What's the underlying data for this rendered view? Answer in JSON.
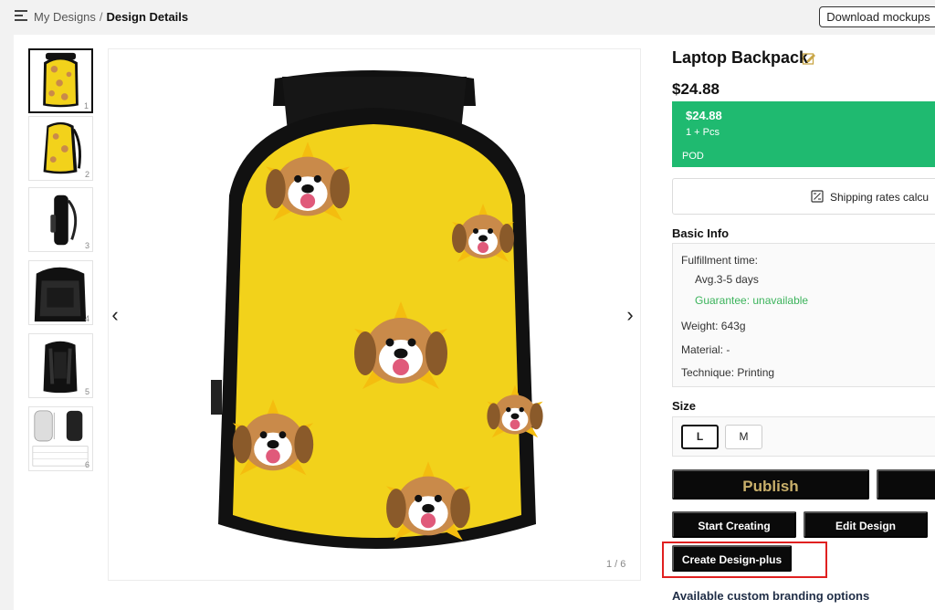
{
  "breadcrumb": {
    "parent": "My Designs",
    "separator": "/",
    "current": "Design Details"
  },
  "download_button": "Download mockups",
  "thumbnails": [
    {
      "num": "1",
      "view": "front"
    },
    {
      "num": "2",
      "view": "angle"
    },
    {
      "num": "3",
      "view": "side"
    },
    {
      "num": "4",
      "view": "inside"
    },
    {
      "num": "5",
      "view": "back"
    },
    {
      "num": "6",
      "view": "size-chart"
    }
  ],
  "viewer": {
    "counter": "1 / 6",
    "prev_icon": "chevron-left-icon",
    "next_icon": "chevron-right-icon"
  },
  "product": {
    "title": "Laptop Backpack",
    "price": "$24.88",
    "tier": {
      "price": "$24.88",
      "quantity": "1 + Pcs",
      "label": "POD",
      "color": "#1fba70"
    },
    "shipping_label": "Shipping rates calcu"
  },
  "basic_info": {
    "heading": "Basic Info",
    "fulfillment_label": "Fulfillment time:",
    "fulfillment_value": "Avg.3-5 days",
    "guarantee": "Guarantee: unavailable",
    "weight": "Weight: 643g",
    "material": "Material: -",
    "technique": "Technique: Printing"
  },
  "size": {
    "heading": "Size",
    "options": [
      "L",
      "M"
    ],
    "selected": "L"
  },
  "actions": {
    "publish": "Publish",
    "start_creating": "Start Creating",
    "edit_design": "Edit Design",
    "create_design_plus": "Create Design-plus"
  },
  "branding_heading": "Available custom branding options",
  "colors": {
    "accent_green": "#1fba70",
    "publish_text": "#c9b06b",
    "highlight": "#e02020",
    "backpack_yellow": "#f2d21b"
  }
}
